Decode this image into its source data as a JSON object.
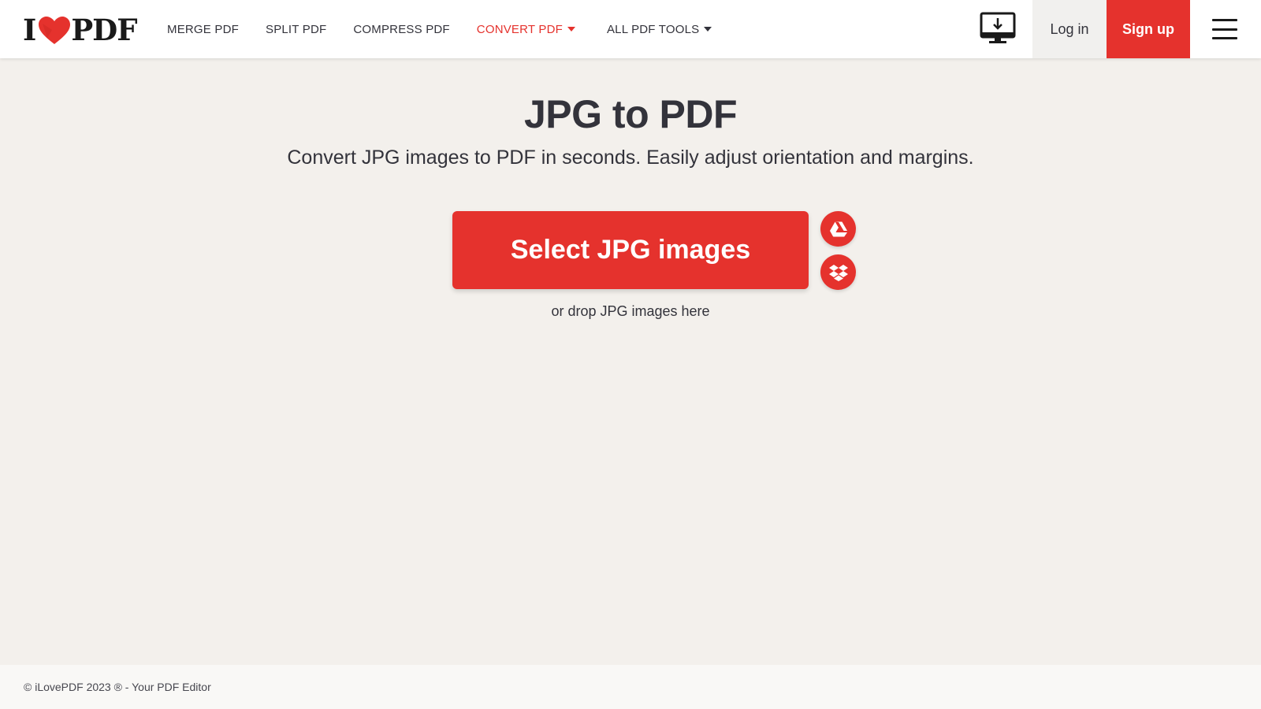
{
  "brand": {
    "logo_left": "I",
    "logo_right": "PDF",
    "accent_color": "#e5322d"
  },
  "nav": {
    "items": [
      {
        "label": "MERGE PDF"
      },
      {
        "label": "SPLIT PDF"
      },
      {
        "label": "COMPRESS PDF"
      },
      {
        "label": "CONVERT PDF",
        "active": true,
        "dropdown": true
      },
      {
        "label": "ALL PDF TOOLS",
        "dropdown": true
      }
    ]
  },
  "header": {
    "desktop_icon": "desktop-download-icon",
    "login_label": "Log in",
    "signup_label": "Sign up",
    "menu_icon": "hamburger-menu-icon"
  },
  "main": {
    "title": "JPG to PDF",
    "subtitle": "Convert JPG images to PDF in seconds. Easily adjust orientation and margins.",
    "select_button_label": "Select JPG images",
    "cloud_buttons": [
      {
        "icon": "google-drive-icon"
      },
      {
        "icon": "dropbox-icon"
      }
    ],
    "drop_hint": "or drop JPG images here"
  },
  "footer": {
    "text": "© iLovePDF 2023 ® - Your PDF Editor"
  }
}
